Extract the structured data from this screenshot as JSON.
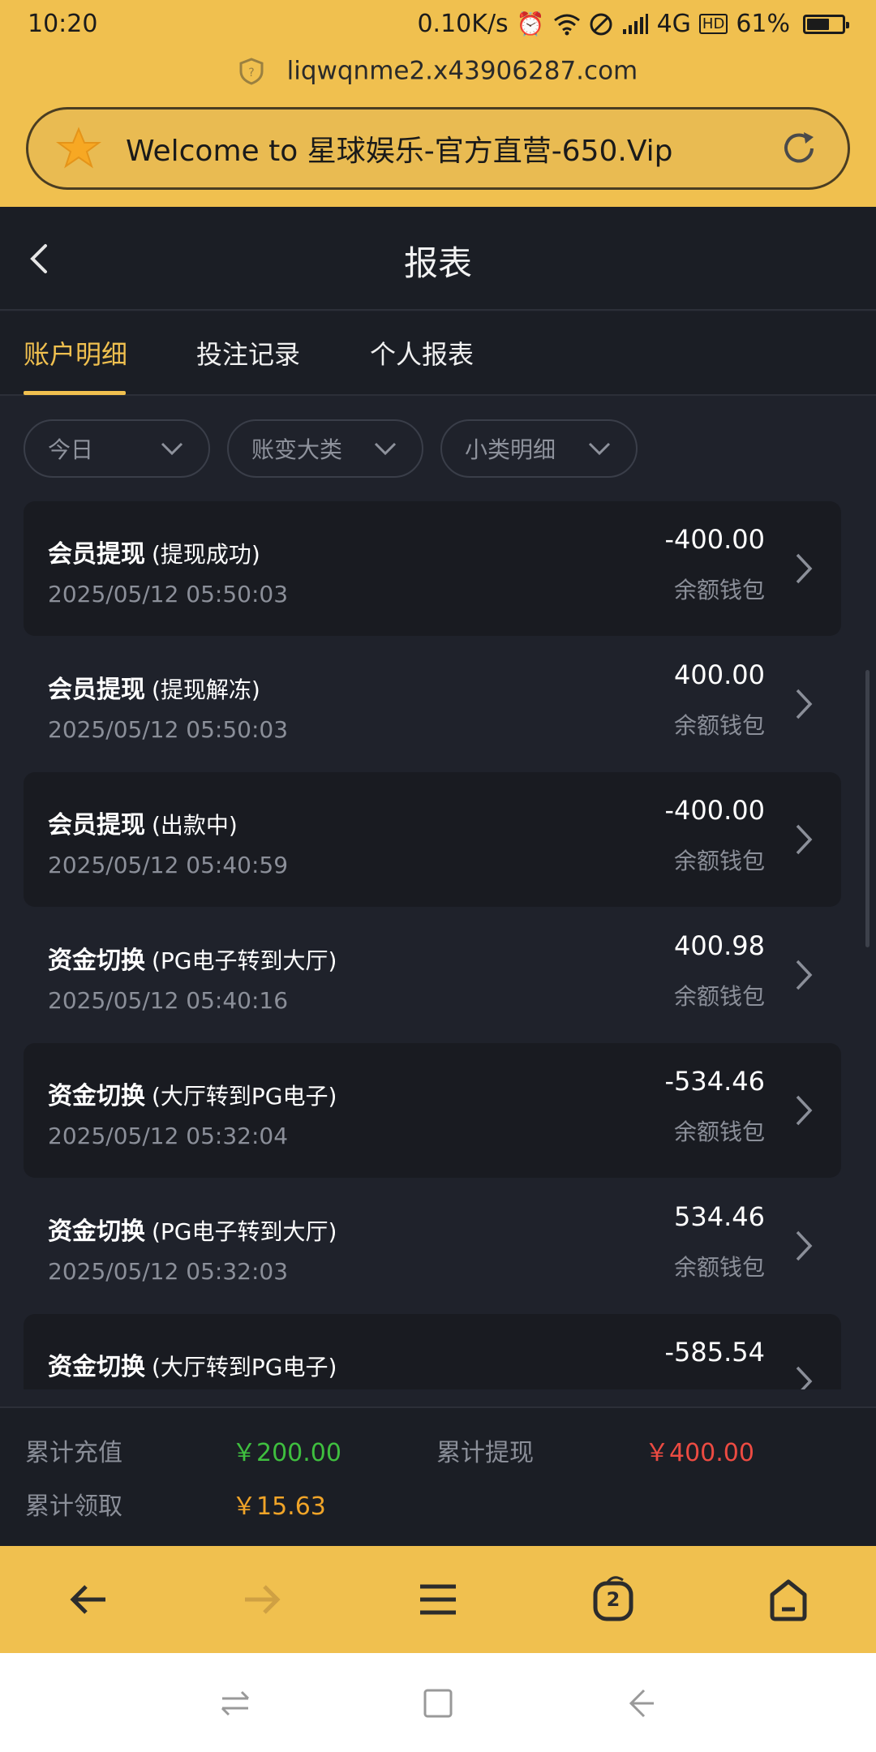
{
  "status_bar": {
    "time": "10:20",
    "net_speed": "0.10K/s",
    "network": "4G",
    "hd": "HD",
    "battery": "61%",
    "battery_level": 0.61
  },
  "browser": {
    "url": "liqwqnme2.x43906287.com",
    "welcome_text": "Welcome to 星球娱乐-官方直营-650.Vip"
  },
  "header": {
    "title": "报表"
  },
  "tabs": [
    {
      "label": "账户明细",
      "active": true
    },
    {
      "label": "投注记录",
      "active": false
    },
    {
      "label": "个人报表",
      "active": false
    }
  ],
  "filters": [
    {
      "label": "今日"
    },
    {
      "label": "账变大类"
    },
    {
      "label": "小类明细"
    }
  ],
  "records": [
    {
      "title": "会员提现",
      "subtitle": "(提现成功)",
      "date": "2025/05/12 05:50:03",
      "amount": "-400.00",
      "wallet": "余额钱包"
    },
    {
      "title": "会员提现",
      "subtitle": "(提现解冻)",
      "date": "2025/05/12 05:50:03",
      "amount": "400.00",
      "wallet": "余额钱包"
    },
    {
      "title": "会员提现",
      "subtitle": "(出款中)",
      "date": "2025/05/12 05:40:59",
      "amount": "-400.00",
      "wallet": "余额钱包"
    },
    {
      "title": "资金切换",
      "subtitle": "(PG电子转到大厅)",
      "date": "2025/05/12 05:40:16",
      "amount": "400.98",
      "wallet": "余额钱包"
    },
    {
      "title": "资金切换",
      "subtitle": "(大厅转到PG电子)",
      "date": "2025/05/12 05:32:04",
      "amount": "-534.46",
      "wallet": "余额钱包"
    },
    {
      "title": "资金切换",
      "subtitle": "(PG电子转到大厅)",
      "date": "2025/05/12 05:32:03",
      "amount": "534.46",
      "wallet": "余额钱包"
    },
    {
      "title": "资金切换",
      "subtitle": "(大厅转到PG电子)",
      "date": "",
      "amount": "-585.54",
      "wallet": ""
    }
  ],
  "summary": {
    "recharge_label": "累计充值",
    "recharge_value": "￥200.00",
    "withdraw_label": "累计提现",
    "withdraw_value": "￥400.00",
    "claim_label": "累计领取",
    "claim_value": "￥15.63"
  },
  "bottom_nav": {
    "tab_count": "2"
  },
  "colors": {
    "accent": "#f0c04f",
    "recharge": "#3fbf3f",
    "withdraw": "#ec4b42",
    "claim": "#f0a428"
  }
}
